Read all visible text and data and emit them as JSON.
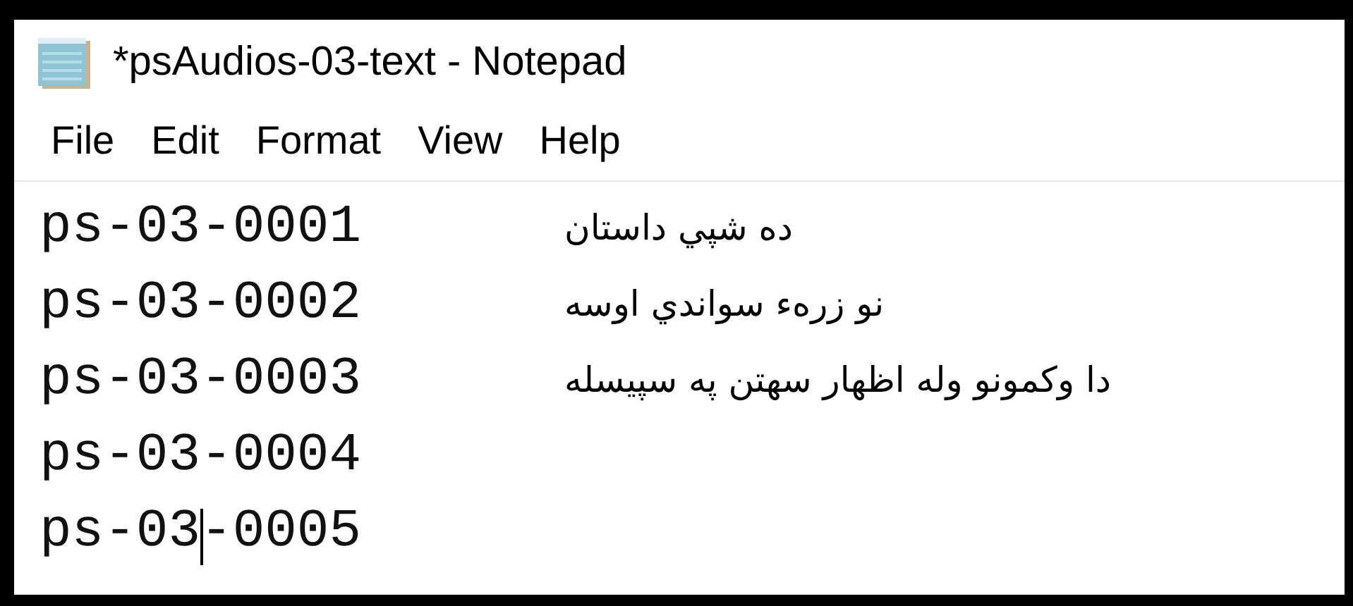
{
  "window": {
    "title": "*psAudios-03-text - Notepad"
  },
  "menu": [
    "File",
    "Edit",
    "Format",
    "View",
    "Help"
  ],
  "lines": [
    {
      "id": "ps-03-0001",
      "text": "ده شپي داستان"
    },
    {
      "id": "ps-03-0002",
      "text": "نو زرهء سواندي اوسه"
    },
    {
      "id": "ps-03-0003",
      "text": "دا وكمونو وله اظهار سهتن په سپيسله"
    },
    {
      "id": "ps-03-0004"
    },
    {
      "id": "ps-03-0005"
    }
  ]
}
